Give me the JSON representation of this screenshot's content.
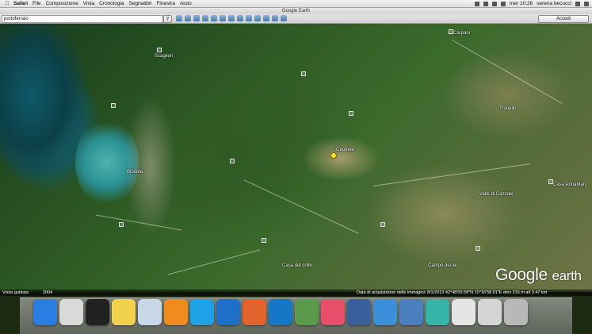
{
  "menubar": {
    "app": "Safari",
    "items": [
      "File",
      "Composizione",
      "Vista",
      "Cronologia",
      "Segnalibri",
      "Finestra",
      "Aiuto"
    ],
    "clock": "mer 10:26",
    "user": "serena becucci"
  },
  "window": {
    "title": "Google Earth"
  },
  "toolbar": {
    "search_value": "portoferraio",
    "signin_label": "Accedi"
  },
  "map": {
    "labels": {
      "scaglieri": "Scaglieri",
      "carpani": "Carpani",
      "ceppete": "Ceppete",
      "trunello": "Trunello",
      "casa_annamaria": "Casa AnnaMari",
      "valle_cazzole": "Valle di Cazzole",
      "biodola": "Biodola",
      "campo_dei_lei": "Campo dei lei",
      "casa_del_colle": "Casa del colle"
    },
    "logo": {
      "google": "Google",
      "earth": "earth"
    }
  },
  "statusbar": {
    "guide": "Visita guidata",
    "year": "2004",
    "info": "Data di acquisizione delle immagini: 8/1/2013    42°48'05.58\"N  10°16'58.01\"E  elev  216 m    alt  3.47 km"
  },
  "dock": {
    "icons": [
      {
        "name": "finder-icon",
        "color": "#2a7de1"
      },
      {
        "name": "printer-icon",
        "color": "#d9d9d9"
      },
      {
        "name": "dashboard-icon",
        "color": "#222222"
      },
      {
        "name": "stickies-icon",
        "color": "#f2d24d"
      },
      {
        "name": "preview-icon",
        "color": "#c9d7e8"
      },
      {
        "name": "ibooks-icon",
        "color": "#f08b1e"
      },
      {
        "name": "skype-icon",
        "color": "#1fa1e6"
      },
      {
        "name": "openoffice-icon",
        "color": "#1f6fc8"
      },
      {
        "name": "firefox-icon",
        "color": "#e2632c"
      },
      {
        "name": "teamviewer-icon",
        "color": "#1577c6"
      },
      {
        "name": "photos-icon",
        "color": "#5a9a4a"
      },
      {
        "name": "itunes-icon",
        "color": "#e94e6a"
      },
      {
        "name": "google-earth-icon",
        "color": "#3a5f9a"
      },
      {
        "name": "safari-icon",
        "color": "#3b8ed8"
      },
      {
        "name": "app-store-icon",
        "color": "#4a7fc0"
      },
      {
        "name": "maps-app-icon",
        "color": "#35b5a8"
      },
      {
        "name": "documents-stack-icon",
        "color": "#e5e5e5"
      },
      {
        "name": "downloads-stack-icon",
        "color": "#d5d5d5"
      },
      {
        "name": "trash-icon",
        "color": "#b8b8b8"
      }
    ]
  }
}
